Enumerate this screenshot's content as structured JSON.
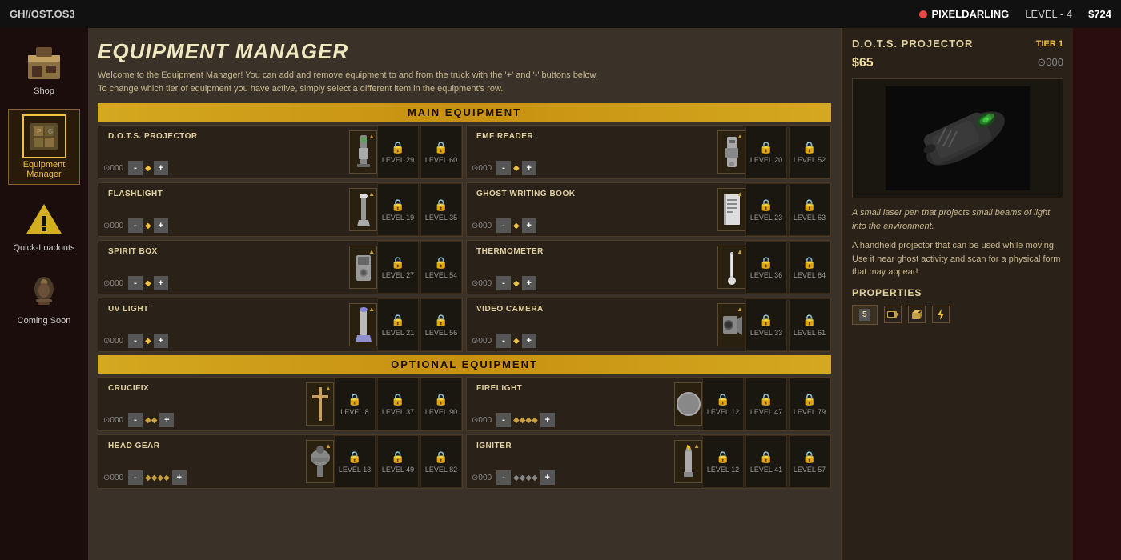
{
  "topbar": {
    "game_id": "GH//OST.OS3",
    "player_name": "PIXELDARLING",
    "level_label": "LEVEL - 4",
    "money": "$724"
  },
  "sidebar": {
    "items": [
      {
        "id": "shop",
        "label": "Shop",
        "icon": "🧰"
      },
      {
        "id": "equipment-manager",
        "label": "Equipment Manager",
        "icon": "📦",
        "active": true
      },
      {
        "id": "quick-loadouts",
        "label": "Quick-Loadouts",
        "icon": "⚡"
      },
      {
        "id": "coming-soon",
        "label": "Coming Soon",
        "icon": "🧥"
      }
    ]
  },
  "panel": {
    "title": "EQUIPMENT MANAGER",
    "desc_line1": "Welcome to the Equipment Manager! You can add and remove equipment to and from the truck with the '+' and '-' buttons below.",
    "desc_line2": "To change which tier of equipment you have active, simply select a different item in the equipment's row.",
    "main_section": "MAIN EQUIPMENT",
    "optional_section": "OPTIONAL EQUIPMENT"
  },
  "main_equipment": [
    {
      "id": "dots-projector",
      "name": "D.O.T.S. PROJECTOR",
      "count": "000",
      "tiers": [
        {
          "level": "LEVEL 29",
          "locked": true
        },
        {
          "level": "LEVEL 60",
          "locked": true
        }
      ]
    },
    {
      "id": "emf-reader",
      "name": "EMF READER",
      "count": "000",
      "tiers": [
        {
          "level": "LEVEL 20",
          "locked": true
        },
        {
          "level": "LEVEL 52",
          "locked": true
        }
      ]
    },
    {
      "id": "flashlight",
      "name": "FLASHLIGHT",
      "count": "000",
      "tiers": [
        {
          "level": "LEVEL 19",
          "locked": true
        },
        {
          "level": "LEVEL 35",
          "locked": true
        }
      ]
    },
    {
      "id": "ghost-writing-book",
      "name": "GHOST WRITING BOOK",
      "count": "000",
      "tiers": [
        {
          "level": "LEVEL 23",
          "locked": true
        },
        {
          "level": "LEVEL 63",
          "locked": true
        }
      ]
    },
    {
      "id": "spirit-box",
      "name": "SPIRIT BOX",
      "count": "000",
      "tiers": [
        {
          "level": "LEVEL 27",
          "locked": true
        },
        {
          "level": "LEVEL 54",
          "locked": true
        }
      ]
    },
    {
      "id": "thermometer",
      "name": "THERMOMETER",
      "count": "000",
      "tiers": [
        {
          "level": "LEVEL 36",
          "locked": true
        },
        {
          "level": "LEVEL 64",
          "locked": true
        }
      ]
    },
    {
      "id": "uv-light",
      "name": "UV LIGHT",
      "count": "000",
      "tiers": [
        {
          "level": "LEVEL 21",
          "locked": true
        },
        {
          "level": "LEVEL 56",
          "locked": true
        }
      ]
    },
    {
      "id": "video-camera",
      "name": "VIDEO CAMERA",
      "count": "000",
      "tiers": [
        {
          "level": "LEVEL 33",
          "locked": true
        },
        {
          "level": "LEVEL 61",
          "locked": true
        }
      ]
    }
  ],
  "optional_equipment": [
    {
      "id": "crucifix",
      "name": "CRUCIFIX",
      "count": "000",
      "tiers": [
        {
          "level": "LEVEL 8",
          "locked": true
        },
        {
          "level": "LEVEL 37",
          "locked": true
        },
        {
          "level": "LEVEL 90",
          "locked": true
        }
      ]
    },
    {
      "id": "firelight",
      "name": "FIRELIGHT",
      "count": "000",
      "tiers": [
        {
          "level": "LEVEL 12",
          "locked": false
        },
        {
          "level": "LEVEL 47",
          "locked": true
        },
        {
          "level": "LEVEL 79",
          "locked": true
        }
      ]
    },
    {
      "id": "head-gear",
      "name": "HEAD GEAR",
      "count": "000",
      "tiers": [
        {
          "level": "LEVEL 13",
          "locked": true
        },
        {
          "level": "LEVEL 49",
          "locked": true
        },
        {
          "level": "LEVEL 82",
          "locked": true
        }
      ]
    },
    {
      "id": "igniter",
      "name": "IGNITER",
      "count": "000",
      "tiers": [
        {
          "level": "LEVEL 12",
          "locked": true
        },
        {
          "level": "LEVEL 41",
          "locked": true
        },
        {
          "level": "LEVEL 57",
          "locked": true
        }
      ]
    }
  ],
  "detail": {
    "title": "D.O.T.S. PROJECTOR",
    "tier": "TIER 1",
    "price": "$65",
    "owned": "⊙000",
    "desc1": "A small laser pen that projects small beams of light into the environment.",
    "desc2": "A handheld projector that can be used while moving. Use it near ghost activity and scan for a physical form that may appear!",
    "properties_label": "PROPERTIES",
    "prop_count": "5",
    "prop_icons": [
      "🔋",
      "📦",
      "⚡"
    ]
  },
  "buttons": {
    "minus": "-",
    "plus": "+",
    "help": "?"
  }
}
